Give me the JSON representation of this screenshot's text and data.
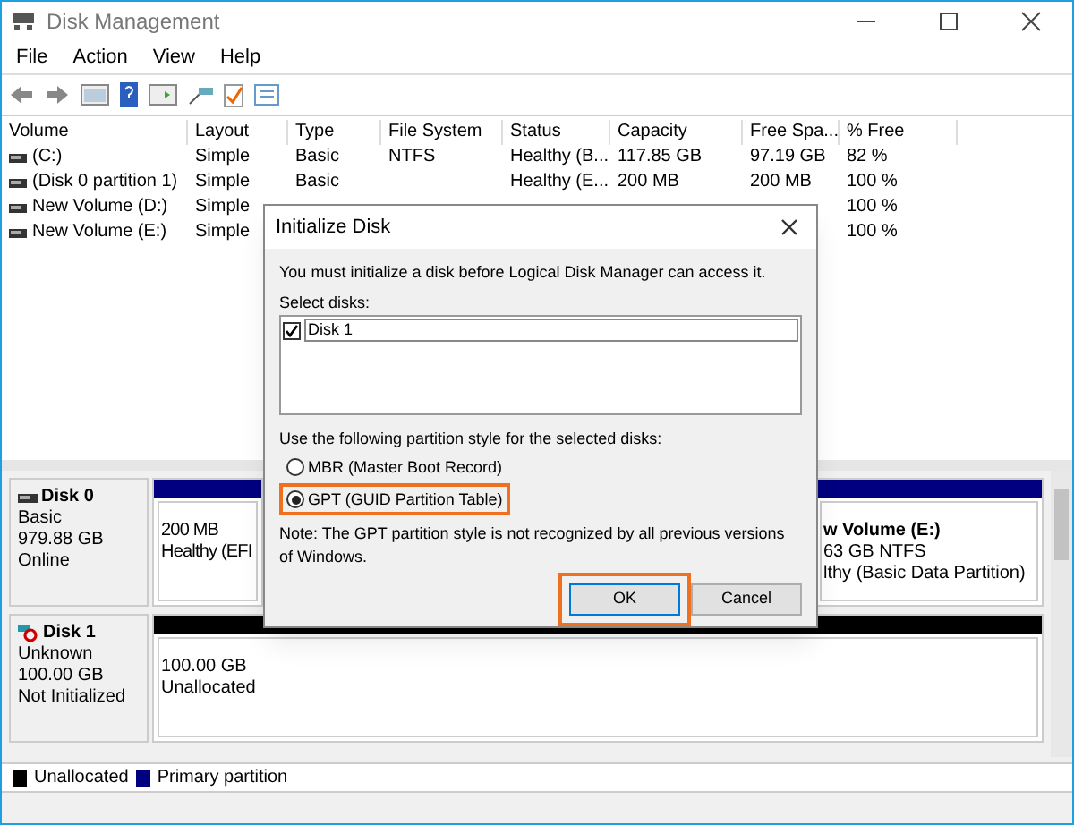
{
  "window": {
    "title": "Disk Management"
  },
  "menu": [
    "File",
    "Action",
    "View",
    "Help"
  ],
  "volume_table": {
    "columns": [
      "Volume",
      "Layout",
      "Type",
      "File System",
      "Status",
      "Capacity",
      "Free Spa...",
      "% Free"
    ],
    "rows": [
      {
        "volume": "(C:)",
        "layout": "Simple",
        "type": "Basic",
        "file_system": "NTFS",
        "status": "Healthy (B...",
        "capacity": "117.85 GB",
        "free_space": "97.19 GB",
        "percent_free": "82 %"
      },
      {
        "volume": "(Disk 0 partition 1)",
        "layout": "Simple",
        "type": "Basic",
        "status": "Healthy (E...",
        "capacity": "200 MB",
        "free_space": "200 MB",
        "percent_free": "100 %"
      },
      {
        "volume": "New Volume (D:)",
        "layout": "Simple",
        "percent_free": "100 %"
      },
      {
        "volume": "New Volume (E:)",
        "layout": "Simple",
        "percent_free": "100 %"
      }
    ]
  },
  "disks": [
    {
      "name": "Disk 0",
      "kind": "online",
      "lines": [
        "Basic",
        "979.88 GB",
        "Online"
      ],
      "partitions": [
        {
          "lines": [
            "200 MB",
            "Healthy (EFI"
          ],
          "kind": "primary"
        },
        {
          "lines": [
            "w Volume  (E:)",
            "63 GB NTFS",
            "lthy (Basic Data Partition)"
          ],
          "kind": "primary"
        }
      ]
    },
    {
      "name": "Disk 1",
      "kind": "not_initialized",
      "lines": [
        "Unknown",
        "100.00 GB",
        "Not Initialized"
      ],
      "partitions": [
        {
          "lines": [
            "100.00 GB",
            "Unallocated"
          ],
          "kind": "unallocated"
        }
      ]
    }
  ],
  "legend": [
    {
      "label": "Unallocated",
      "color": "#000000"
    },
    {
      "label": "Primary partition",
      "color": "#000080"
    }
  ],
  "dialog": {
    "title": "Initialize Disk",
    "message": "You must initialize a disk before Logical Disk Manager can access it.",
    "select_label": "Select disks:",
    "disks": [
      {
        "label": "Disk 1",
        "checked": true
      }
    ],
    "style_label": "Use the following partition style for the selected disks:",
    "styles": [
      {
        "label": "MBR (Master Boot Record)",
        "selected": false
      },
      {
        "label": "GPT (GUID Partition Table)",
        "selected": true
      }
    ],
    "note": "Note: The GPT partition style is not recognized by all previous versions of Windows.",
    "buttons": [
      {
        "label": "OK",
        "default": true
      },
      {
        "label": "Cancel",
        "default": false
      }
    ]
  }
}
